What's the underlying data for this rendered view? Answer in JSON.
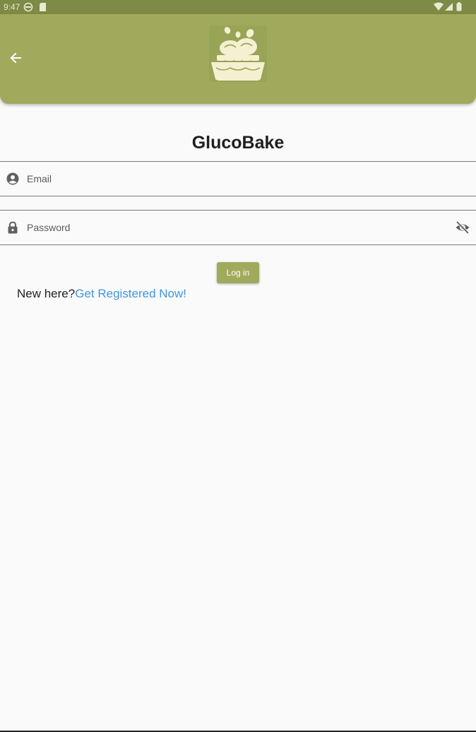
{
  "status_bar": {
    "time": "9:47",
    "icons": [
      "sync-icon",
      "sd-card-icon",
      "wifi-icon",
      "signal-icon",
      "battery-icon"
    ]
  },
  "app_bar": {
    "back_icon": "arrow-left-icon",
    "logo": "bread-basket-logo",
    "color": "#a1aa5c"
  },
  "title": "GlucoBake",
  "form": {
    "email": {
      "icon": "account-circle-icon",
      "placeholder": "Email",
      "value": ""
    },
    "password": {
      "icon": "lock-icon",
      "placeholder": "Password",
      "value": "",
      "toggle_icon": "eye-off-icon"
    },
    "login_label": "Log in"
  },
  "register": {
    "prompt": "New here?",
    "link": "Get Registered Now!",
    "link_color": "#3f96e0"
  }
}
